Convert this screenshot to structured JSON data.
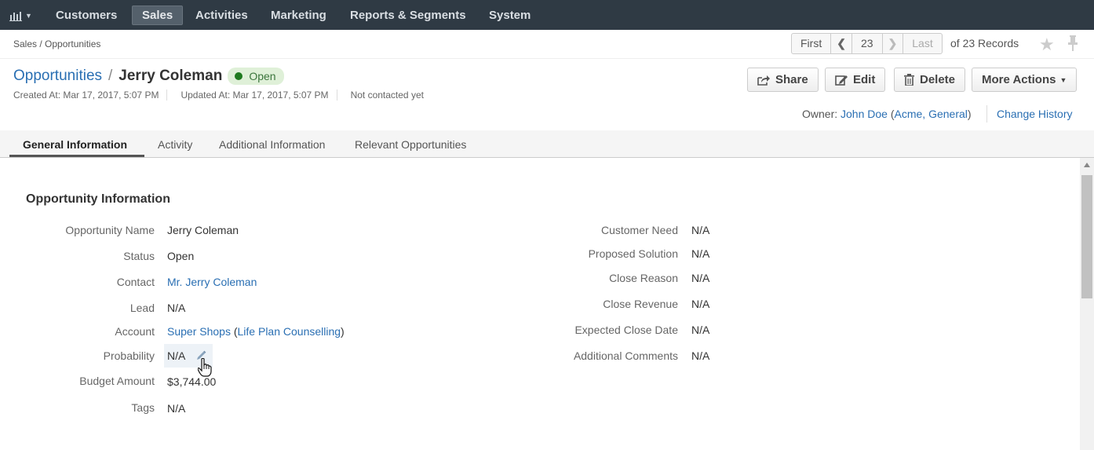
{
  "topnav": {
    "dashboard_icon": "bar-chart-icon",
    "items": [
      {
        "label": "Customers"
      },
      {
        "label": "Sales",
        "active": true
      },
      {
        "label": "Activities"
      },
      {
        "label": "Marketing"
      },
      {
        "label": "Reports & Segments"
      },
      {
        "label": "System"
      }
    ]
  },
  "breadcrumb": "Sales / Opportunities",
  "pager": {
    "first": "First",
    "current": "23",
    "last": "Last",
    "records": "of 23 Records"
  },
  "title": {
    "entity_link": "Opportunities",
    "separator": "/",
    "name": "Jerry Coleman",
    "status": "Open"
  },
  "meta": {
    "created": "Created At: Mar 17, 2017, 5:07 PM",
    "updated": "Updated At: Mar 17, 2017, 5:07 PM",
    "contacted": "Not contacted yet"
  },
  "actions": {
    "share": "Share",
    "edit": "Edit",
    "delete": "Delete",
    "more": "More Actions"
  },
  "owner": {
    "label": "Owner:",
    "name": "John Doe",
    "org": "Acme, General",
    "change_history": "Change History"
  },
  "tabs": [
    {
      "label": "General Information",
      "active": true
    },
    {
      "label": "Activity"
    },
    {
      "label": "Additional Information"
    },
    {
      "label": "Relevant Opportunities"
    }
  ],
  "section_title": "Opportunity Information",
  "left_fields": [
    {
      "label": "Opportunity Name",
      "value": "Jerry Coleman"
    },
    {
      "label": "Status",
      "value": "Open"
    },
    {
      "label": "Contact",
      "value": "Mr. Jerry Coleman"
    },
    {
      "label": "Lead",
      "value": "N/A"
    },
    {
      "label": "Account",
      "value": "Super Shops",
      "value_extra": "Life Plan Counselling"
    },
    {
      "label": "Probability",
      "value": "N/A"
    },
    {
      "label": "Budget Amount",
      "value": "$3,744.00"
    },
    {
      "label": "Tags",
      "value": "N/A"
    }
  ],
  "right_fields": [
    {
      "label": "Customer Need",
      "value": "N/A"
    },
    {
      "label": "Proposed Solution",
      "value": "N/A"
    },
    {
      "label": "Close Reason",
      "value": "N/A"
    },
    {
      "label": "Close Revenue",
      "value": "N/A"
    },
    {
      "label": "Expected Close Date",
      "value": "N/A"
    },
    {
      "label": "Additional Comments",
      "value": "N/A"
    }
  ],
  "colors": {
    "nav_bg": "#2f3a44",
    "link": "#2a6fb3",
    "status_bg": "#dff0d8",
    "status_dot": "#1f7a1f"
  }
}
